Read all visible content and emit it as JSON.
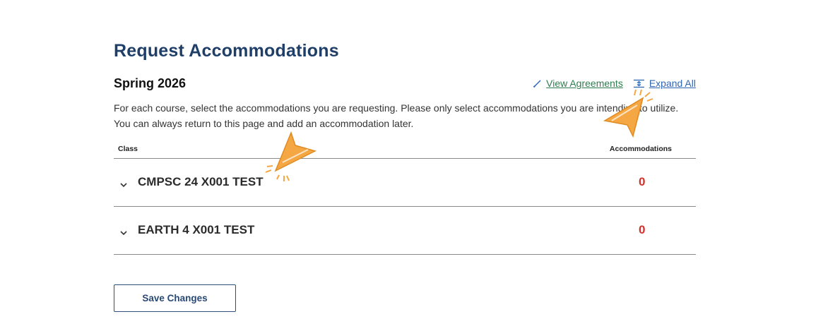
{
  "page": {
    "title": "Request Accommodations"
  },
  "term": {
    "label": "Spring 2026",
    "view_agreements": "View Agreements",
    "expand_all": "Expand All"
  },
  "intro": "For each course, select the accommodations you are requesting. Please only select accommodations you are intending to utilize. You can always return to this page and add an accommodation later.",
  "table": {
    "col_class": "Class",
    "col_accommodations": "Accommodations",
    "rows": [
      {
        "course": "CMPSC 24 X001 TEST",
        "count": "0"
      },
      {
        "course": "EARTH 4 X001 TEST",
        "count": "0"
      }
    ]
  },
  "actions": {
    "save_label": "Save Changes"
  },
  "icons": {
    "view_agreements": "pencil-icon",
    "expand_all": "expand-icon",
    "row_toggle": "chevron-down-icon",
    "pointer": "click-pointer-icon"
  },
  "colors": {
    "title": "#1f3f68",
    "view_link": "#2e7d4f",
    "expand_link": "#2f66b3",
    "count": "#d1322b",
    "pointer": "#f4a742"
  }
}
